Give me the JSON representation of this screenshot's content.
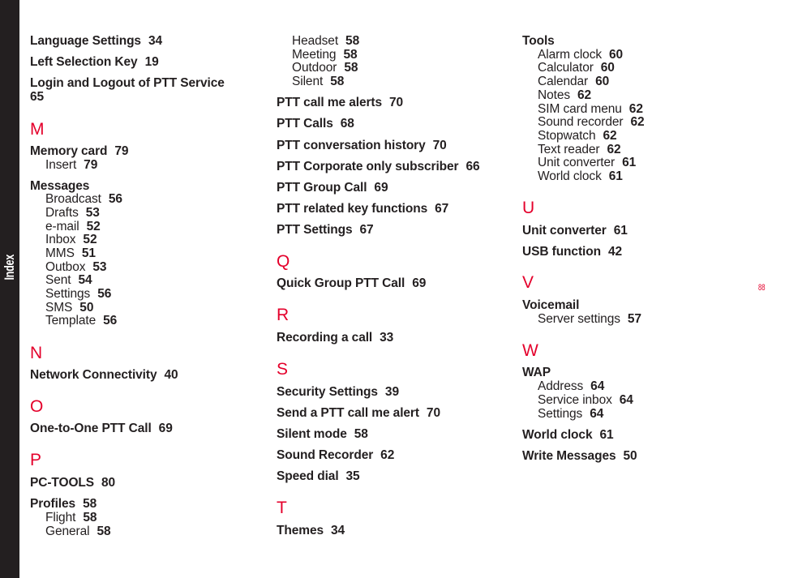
{
  "sidebar": {
    "label": "Index"
  },
  "page_number": "88",
  "colors": {
    "accent": "#e4002b",
    "text": "#231f20",
    "sidebar": "#231f20"
  },
  "columns": [
    [
      {
        "type": "main",
        "text": "Language Settings",
        "page": "34"
      },
      {
        "type": "main",
        "text": "Left Selection Key",
        "page": "19"
      },
      {
        "type": "main",
        "text": "Login and Logout of PTT Service",
        "page": "65",
        "wrap": true
      },
      {
        "type": "letter",
        "text": "M"
      },
      {
        "type": "main",
        "text": "Memory card",
        "page": "79"
      },
      {
        "type": "sub",
        "text": "Insert",
        "page": "79"
      },
      {
        "type": "main",
        "text": "Messages",
        "page": ""
      },
      {
        "type": "sub",
        "text": "Broadcast",
        "page": "56"
      },
      {
        "type": "sub",
        "text": "Drafts",
        "page": "53"
      },
      {
        "type": "sub",
        "text": "e-mail",
        "page": "52"
      },
      {
        "type": "sub",
        "text": "Inbox",
        "page": "52"
      },
      {
        "type": "sub",
        "text": "MMS",
        "page": "51"
      },
      {
        "type": "sub",
        "text": "Outbox",
        "page": "53"
      },
      {
        "type": "sub",
        "text": "Sent",
        "page": "54"
      },
      {
        "type": "sub",
        "text": "Settings",
        "page": "56"
      },
      {
        "type": "sub",
        "text": "SMS",
        "page": "50"
      },
      {
        "type": "sub",
        "text": "Template",
        "page": "56"
      },
      {
        "type": "letter",
        "text": "N"
      },
      {
        "type": "main",
        "text": "Network Connectivity",
        "page": "40"
      },
      {
        "type": "letter",
        "text": "O"
      },
      {
        "type": "main",
        "text": "One-to-One PTT Call",
        "page": "69"
      },
      {
        "type": "letter",
        "text": "P"
      },
      {
        "type": "main",
        "text": "PC-TOOLS",
        "page": "80"
      },
      {
        "type": "main",
        "text": "Profiles",
        "page": "58"
      },
      {
        "type": "sub",
        "text": "Flight",
        "page": "58"
      },
      {
        "type": "sub",
        "text": "General",
        "page": "58"
      }
    ],
    [
      {
        "type": "sub",
        "text": "Headset",
        "page": "58"
      },
      {
        "type": "sub",
        "text": "Meeting",
        "page": "58"
      },
      {
        "type": "sub",
        "text": "Outdoor",
        "page": "58"
      },
      {
        "type": "sub",
        "text": "Silent",
        "page": "58"
      },
      {
        "type": "main",
        "text": "PTT call me alerts",
        "page": "70"
      },
      {
        "type": "main",
        "text": "PTT Calls",
        "page": "68"
      },
      {
        "type": "main",
        "text": "PTT conversation history",
        "page": "70"
      },
      {
        "type": "main",
        "text": "PTT Corporate only subscriber",
        "page": "66"
      },
      {
        "type": "main",
        "text": "PTT Group Call",
        "page": "69"
      },
      {
        "type": "main",
        "text": "PTT related key functions",
        "page": "67"
      },
      {
        "type": "main",
        "text": "PTT Settings",
        "page": "67"
      },
      {
        "type": "letter",
        "text": "Q"
      },
      {
        "type": "main",
        "text": "Quick Group PTT Call",
        "page": "69"
      },
      {
        "type": "letter",
        "text": "R"
      },
      {
        "type": "main",
        "text": "Recording a call",
        "page": "33"
      },
      {
        "type": "letter",
        "text": "S"
      },
      {
        "type": "main",
        "text": "Security Settings",
        "page": "39"
      },
      {
        "type": "main",
        "text": "Send a PTT call me alert",
        "page": "70"
      },
      {
        "type": "main",
        "text": "Silent mode",
        "page": "58"
      },
      {
        "type": "main",
        "text": "Sound Recorder",
        "page": "62"
      },
      {
        "type": "main",
        "text": "Speed dial",
        "page": "35"
      },
      {
        "type": "letter",
        "text": "T"
      },
      {
        "type": "main",
        "text": "Themes",
        "page": "34"
      }
    ],
    [
      {
        "type": "main",
        "text": "Tools",
        "page": ""
      },
      {
        "type": "sub",
        "text": "Alarm clock",
        "page": "60"
      },
      {
        "type": "sub",
        "text": "Calculator",
        "page": "60"
      },
      {
        "type": "sub",
        "text": "Calendar",
        "page": "60"
      },
      {
        "type": "sub",
        "text": "Notes",
        "page": "62"
      },
      {
        "type": "sub",
        "text": "SIM card menu",
        "page": "62"
      },
      {
        "type": "sub",
        "text": "Sound recorder",
        "page": "62"
      },
      {
        "type": "sub",
        "text": "Stopwatch",
        "page": "62"
      },
      {
        "type": "sub",
        "text": "Text reader",
        "page": "62"
      },
      {
        "type": "sub",
        "text": "Unit converter",
        "page": "61"
      },
      {
        "type": "sub",
        "text": "World clock",
        "page": "61"
      },
      {
        "type": "letter",
        "text": "U"
      },
      {
        "type": "main",
        "text": "Unit converter",
        "page": "61"
      },
      {
        "type": "main",
        "text": "USB function",
        "page": "42"
      },
      {
        "type": "letter",
        "text": "V"
      },
      {
        "type": "main",
        "text": "Voicemail",
        "page": ""
      },
      {
        "type": "sub",
        "text": "Server settings",
        "page": "57"
      },
      {
        "type": "letter",
        "text": "W"
      },
      {
        "type": "main",
        "text": "WAP",
        "page": ""
      },
      {
        "type": "sub",
        "text": "Address",
        "page": "64"
      },
      {
        "type": "sub",
        "text": "Service inbox",
        "page": "64"
      },
      {
        "type": "sub",
        "text": "Settings",
        "page": "64"
      },
      {
        "type": "main",
        "text": "World clock",
        "page": "61"
      },
      {
        "type": "main",
        "text": "Write Messages",
        "page": "50"
      }
    ]
  ]
}
